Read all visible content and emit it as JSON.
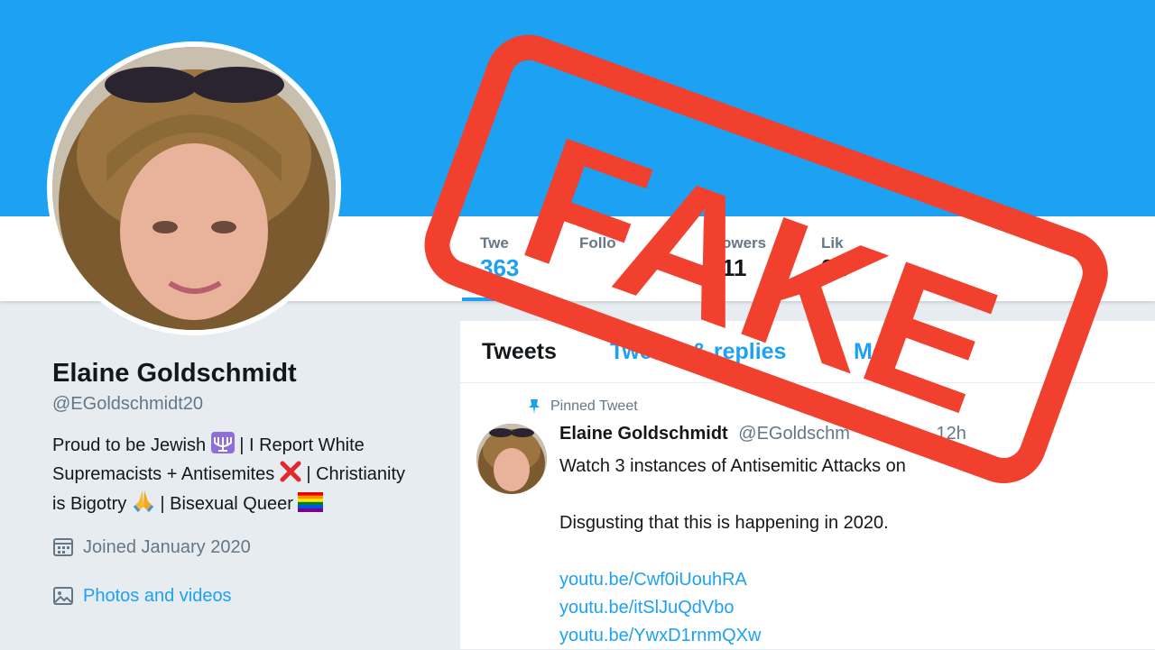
{
  "profile": {
    "name": "Elaine Goldschmidt",
    "handle": "@EGoldschmidt20",
    "bio_line1": "Proud to be Jewish",
    "bio_part2": "| I Report White",
    "bio_line2": "Supremacists + Antisemites",
    "bio_part3": "| Christianity",
    "bio_line3": "is Bigotry",
    "bio_part4": "| Bisexual Queer",
    "joined": "Joined January 2020",
    "photos_link": "Photos and videos"
  },
  "stats": [
    {
      "label": "Twe",
      "value": "363"
    },
    {
      "label": "Follo",
      "value": ""
    },
    {
      "label": "owers",
      "value": "11"
    },
    {
      "label": "Lik",
      "value": "22"
    }
  ],
  "timeline": {
    "tabs": [
      "Tweets",
      "Tweets & replies",
      "Me"
    ],
    "pinned_label": "Pinned Tweet",
    "tweet": {
      "name": "Elaine Goldschmidt",
      "handle": "@EGoldschm",
      "time": "12h",
      "line1": "Watch 3 instances of Antisemitic Attacks on",
      "line2": "Disgusting that this is happening in 2020.",
      "links": [
        "youtu.be/Cwf0iUouhRA",
        "youtu.be/itSlJuQdVbo",
        "youtu.be/YwxD1rnmQXw"
      ]
    }
  },
  "overlay": {
    "stamp_text": "FAKE"
  },
  "colors": {
    "twitter_blue": "#1da1f2",
    "stamp_red": "#f2402f"
  }
}
